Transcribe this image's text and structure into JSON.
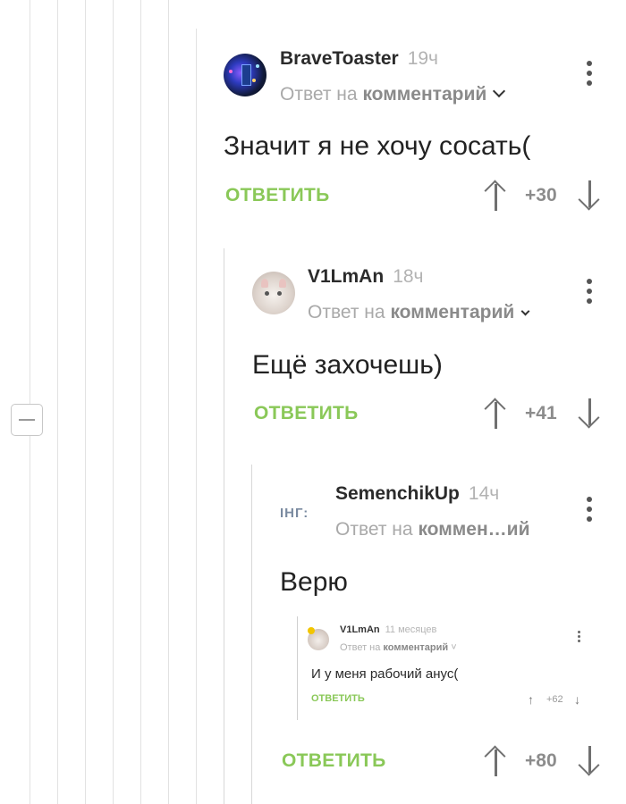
{
  "comments": [
    {
      "username": "BraveToaster",
      "time": "19ч",
      "reply_prefix": "Ответ на",
      "reply_target": "комментарий",
      "body": "Значит я не хочу сосать(",
      "reply_label": "ОТВЕТИТЬ",
      "score": "+30",
      "avatar": "tardis-avatar"
    },
    {
      "username": "V1LmAn",
      "time": "18ч",
      "reply_prefix": "Ответ на",
      "reply_target": "комментарий",
      "body": "Ещё захочешь)",
      "reply_label": "ОТВЕТИТЬ",
      "score": "+41",
      "avatar": "cat-avatar"
    },
    {
      "username": "SemenchikUp",
      "time": "14ч",
      "reply_prefix": "Ответ на",
      "reply_target": "коммен…ий",
      "body": "Верю",
      "reply_label": "ОТВЕТИТЬ",
      "score": "+80",
      "avatar_text": "ІНГ:"
    }
  ],
  "embedded": {
    "username": "V1LmAn",
    "time": "11 месяцев",
    "reply_prefix": "Ответ на",
    "reply_target": "комментарий",
    "body": "И у меня рабочий анус(",
    "reply_label": "ОТВЕТИТЬ",
    "score": "+62"
  },
  "colors": {
    "accent_green": "#8ac858",
    "username": "#2b2b2b",
    "muted": "#a9a9a9"
  }
}
